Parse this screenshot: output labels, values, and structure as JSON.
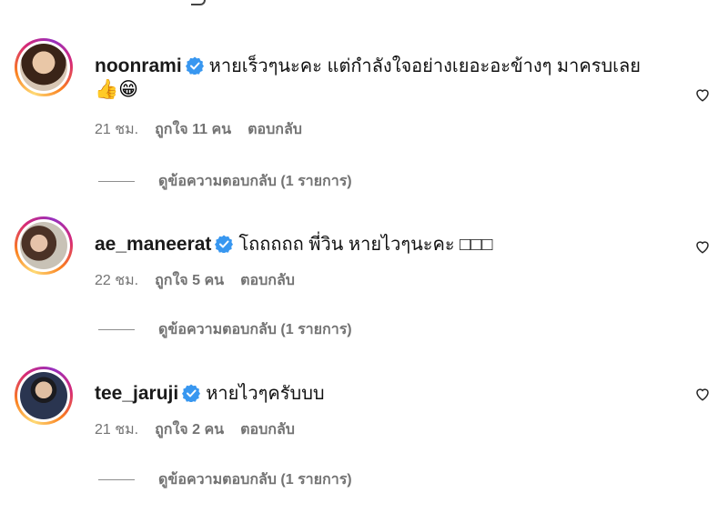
{
  "comments": [
    {
      "username": "noonrami",
      "text": "หายเร็วๆนะคะ แต่กำลังใจอย่างเยอะอะข้างๆ มาครบเลย",
      "text_line2": "👍😁",
      "time": "21 ชม.",
      "likes": "ถูกใจ 11 คน",
      "reply": "ตอบกลับ",
      "view_replies": "ดูข้อความตอบกลับ (1 รายการ)"
    },
    {
      "username": "ae_maneerat",
      "text": "โถถถถถ พี่วิน หายไวๆนะคะ □□□",
      "time": "22 ชม.",
      "likes": "ถูกใจ 5 คน",
      "reply": "ตอบกลับ",
      "view_replies": "ดูข้อความตอบกลับ (1 รายการ)"
    },
    {
      "username": "tee_jaruji",
      "text": "หายไวๆครับบบ",
      "time": "21 ชม.",
      "likes": "ถูกใจ 2 คน",
      "reply": "ตอบกลับ",
      "view_replies": "ดูข้อความตอบกลับ (1 รายการ)"
    }
  ],
  "colors": {
    "verified": "#3897f0",
    "meta_text": "#737373"
  },
  "icons": [
    "verified-badge-icon",
    "heart-icon"
  ]
}
